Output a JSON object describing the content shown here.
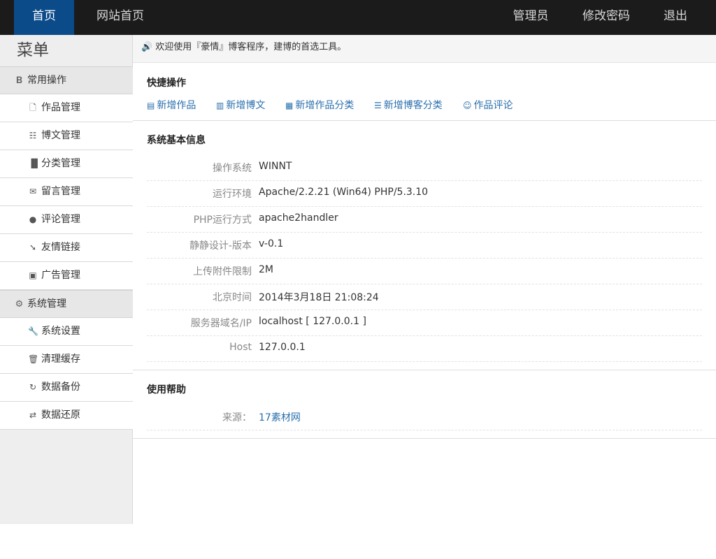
{
  "topnav": {
    "home": "首页",
    "site_home": "网站首页",
    "admin": "管理员",
    "change_password": "修改密码",
    "logout": "退出"
  },
  "sidebar": {
    "title": "菜单",
    "groups": [
      {
        "label": "常用操作",
        "icon": "bold-b-icon",
        "items": [
          {
            "label": "作品管理",
            "icon": "file-icon"
          },
          {
            "label": "博文管理",
            "icon": "document-icon"
          },
          {
            "label": "分类管理",
            "icon": "books-icon"
          },
          {
            "label": "留言管理",
            "icon": "envelope-icon"
          },
          {
            "label": "评论管理",
            "icon": "comment-icon"
          },
          {
            "label": "友情链接",
            "icon": "plug-icon"
          },
          {
            "label": "广告管理",
            "icon": "picture-icon"
          }
        ]
      },
      {
        "label": "系统管理",
        "icon": "gear-icon",
        "items": [
          {
            "label": "系统设置",
            "icon": "wrench-icon"
          },
          {
            "label": "清理缓存",
            "icon": "trash-icon"
          },
          {
            "label": "数据备份",
            "icon": "repeat-icon"
          },
          {
            "label": "数据还原",
            "icon": "refresh-icon"
          }
        ]
      }
    ]
  },
  "welcome": "欢迎使用『豪情』博客程序，建博的首选工具。",
  "quick": {
    "title": "快捷操作",
    "links": [
      {
        "label": "新增作品",
        "icon": "id-card-icon"
      },
      {
        "label": "新增博文",
        "icon": "list-document-icon"
      },
      {
        "label": "新增作品分类",
        "icon": "list-box-icon"
      },
      {
        "label": "新增博客分类",
        "icon": "align-justify-icon"
      },
      {
        "label": "作品评论",
        "icon": "smile-icon"
      }
    ]
  },
  "sysinfo": {
    "title": "系统基本信息",
    "rows": [
      {
        "label": "操作系统",
        "value": "WINNT"
      },
      {
        "label": "运行环境",
        "value": "Apache/2.2.21 (Win64) PHP/5.3.10"
      },
      {
        "label": "PHP运行方式",
        "value": "apache2handler"
      },
      {
        "label": "静静设计-版本",
        "value": "v-0.1"
      },
      {
        "label": "上传附件限制",
        "value": "2M"
      },
      {
        "label": "北京时间",
        "value": "2014年3月18日 21:08:24"
      },
      {
        "label": "服务器域名/IP",
        "value": "localhost [ 127.0.0.1 ]"
      },
      {
        "label": "Host",
        "value": "127.0.0.1"
      }
    ]
  },
  "help": {
    "title": "使用帮助",
    "source_label": "来源：",
    "source_value": "17素材网"
  },
  "colors": {
    "topbar_bg": "#1b1b1b",
    "active_tab": "#0b4b8a",
    "link": "#2a6fad"
  }
}
